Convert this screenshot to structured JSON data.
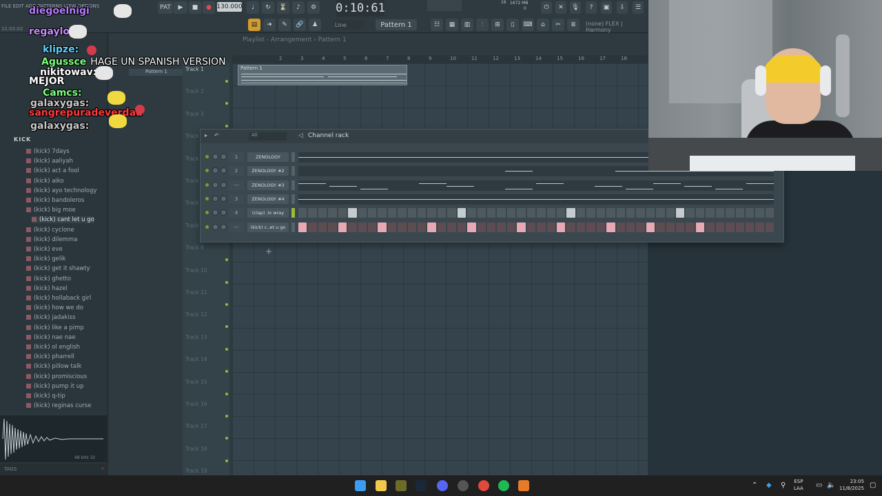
{
  "toolbar": {
    "menu_text": "FILE EDIT ADD PATTERNS VIEW OPTIONS",
    "tempo": "130.000",
    "time": "0:10:61",
    "cpu": "1672 MB",
    "cpu_val": "0",
    "cpu_top": "16",
    "pattern_select": "Pattern 1",
    "snap_select": "Line",
    "hint": "(none) FLEX | Harmony"
  },
  "browser": {
    "time_left": "11:02:02",
    "header": "KICK",
    "items": [
      "(kick) 7days",
      "(kick) aaliyah",
      "(kick) act a fool",
      "(kick) aiko",
      "(kick) ayo technology",
      "(kick) bandoleros",
      "(kick) big moe",
      "(kick) cant let u go",
      "(kick) cyclone",
      "(kick) dilemma",
      "(kick) eve",
      "(kick) gelik",
      "(kick) get it shawty",
      "(kick) ghetto",
      "(kick) hazel",
      "(kick) hollaback girl",
      "(kick) how we do",
      "(kick) jadakiss",
      "(kick) like a pimp",
      "(kick) nae nae",
      "(kick) ol english",
      "(kick) pharrell",
      "(kick) pillow talk",
      "(kick) promiscious",
      "(kick) pump it up",
      "(kick) q-tip",
      "(kick) reginas curse"
    ],
    "selected_index": 7,
    "wave_info": "48 kHz 32",
    "tags": "TAGS"
  },
  "playlist": {
    "title": "Playlist - Arrangement › Pattern 1",
    "pattern_item": "Pattern 1",
    "clip_label": "Pattern 1",
    "ruler": [
      "2",
      "3",
      "4",
      "5",
      "6",
      "7",
      "8",
      "9",
      "10",
      "11",
      "12",
      "13",
      "14",
      "15",
      "16",
      "17",
      "18"
    ],
    "tracks": [
      "Track 1",
      "Track 2",
      "Track 3",
      "Track 4",
      "Track 5",
      "Track 6",
      "Track 7",
      "Track 8",
      "Track 9",
      "Track 10",
      "Track 11",
      "Track 12",
      "Track 13",
      "Track 14",
      "Track 15",
      "Track 16",
      "Track 17",
      "Track 18",
      "Track 19"
    ]
  },
  "rack": {
    "title": "Channel rack",
    "filter": "All",
    "channels": [
      {
        "num": "1",
        "name": "ZENOLOGY",
        "type": "roll"
      },
      {
        "num": "2",
        "name": "ZENOLOGY #2",
        "type": "roll"
      },
      {
        "num": "---",
        "name": "ZENOLOGY #3",
        "type": "roll"
      },
      {
        "num": "3",
        "name": "ZENOLOGY #4",
        "type": "roll"
      },
      {
        "num": "4",
        "name": "(clap) .lx wray",
        "type": "steps"
      },
      {
        "num": "---",
        "name": "(kick) c..et u go",
        "type": "steps-pink"
      }
    ],
    "clap_steps": [
      5,
      16,
      27,
      38
    ],
    "kick_steps": [
      0,
      4,
      8,
      13,
      17,
      22,
      26,
      31,
      35,
      40
    ],
    "add": "+"
  },
  "chat": [
    {
      "user": "diegoelnigi",
      "color": "#b57cff",
      "msg": ""
    },
    {
      "user": "regaylo:",
      "color": "#c58cff",
      "msg": ""
    },
    {
      "user": "klipze:",
      "color": "#5fd0ff",
      "msg": ""
    },
    {
      "user": "Agussce",
      "color": "#7cff7c",
      "msg": "HAGE UN SPANISH VERSION"
    },
    {
      "user": "nikitowav:",
      "color": "#ffffff",
      "msg": ""
    },
    {
      "user": "MEJOR",
      "color": "#ffffff",
      "msg": ""
    },
    {
      "user": "Camcs:",
      "color": "#7cff7c",
      "msg": ""
    },
    {
      "user": "galaxygas:",
      "color": "#c9c9c9",
      "msg": ""
    },
    {
      "user": "sangrepuradeverdad",
      "color": "#ff3a3a",
      "msg": ""
    },
    {
      "user": "galaxygas:",
      "color": "#c9c9c9",
      "msg": ""
    }
  ],
  "taskbar": {
    "lang1": "ESP",
    "lang2": "LAA",
    "time": "23:05",
    "date": "11/8/2025"
  }
}
